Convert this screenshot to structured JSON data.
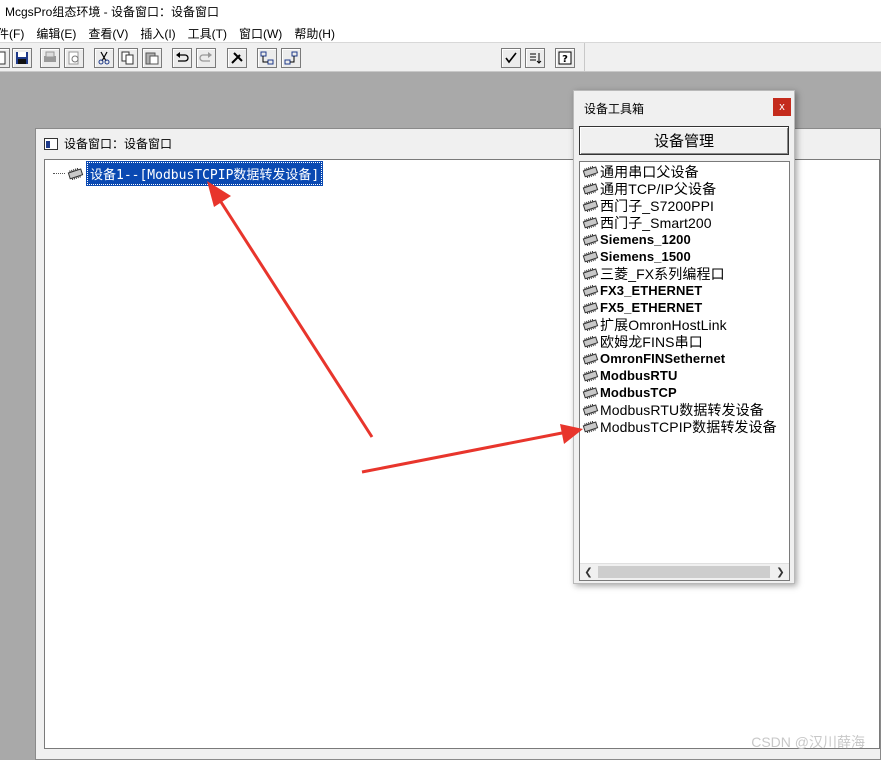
{
  "titlebar": {
    "title": "McgsPro组态环境 - 设备窗口：设备窗口"
  },
  "menubar": {
    "items": [
      "件(F)",
      "编辑(E)",
      "查看(V)",
      "插入(I)",
      "工具(T)",
      "窗口(W)",
      "帮助(H)"
    ]
  },
  "toolbar": {
    "buttons": [
      "new-file-icon",
      "save-icon",
      "print-icon",
      "print-preview-icon",
      "cut-icon",
      "copy-icon",
      "paste-icon",
      "undo-icon",
      "redo-icon",
      "tools-icon",
      "device-tree-icon",
      "device-tree-alt-icon",
      "check-icon",
      "list-sort-icon",
      "help-icon"
    ]
  },
  "device_window": {
    "title": "设备窗口：设备窗口",
    "selected_item": "设备1--[ModbusTCPIP数据转发设备]"
  },
  "toolbox": {
    "title": "设备工具箱",
    "close_label": "x",
    "manage_button": "设备管理",
    "devices": [
      "通用串口父设备",
      "通用TCP/IP父设备",
      "西门子_S7200PPI",
      "西门子_Smart200",
      "Siemens_1200",
      "Siemens_1500",
      "三菱_FX系列编程口",
      "FX3_ETHERNET",
      "FX5_ETHERNET",
      "扩展OmronHostLink",
      "欧姆龙FINS串口",
      "OmronFINSethernet",
      "ModbusRTU",
      "ModbusTCP",
      "ModbusRTU数据转发设备",
      "ModbusTCPIP数据转发设备"
    ]
  },
  "watermark": "CSDN @汉川薛海",
  "colors": {
    "selection": "#0a49b2",
    "annotation_arrow": "#e8352c",
    "close_button": "#c42b1c",
    "desktop": "#a9a9a9"
  }
}
